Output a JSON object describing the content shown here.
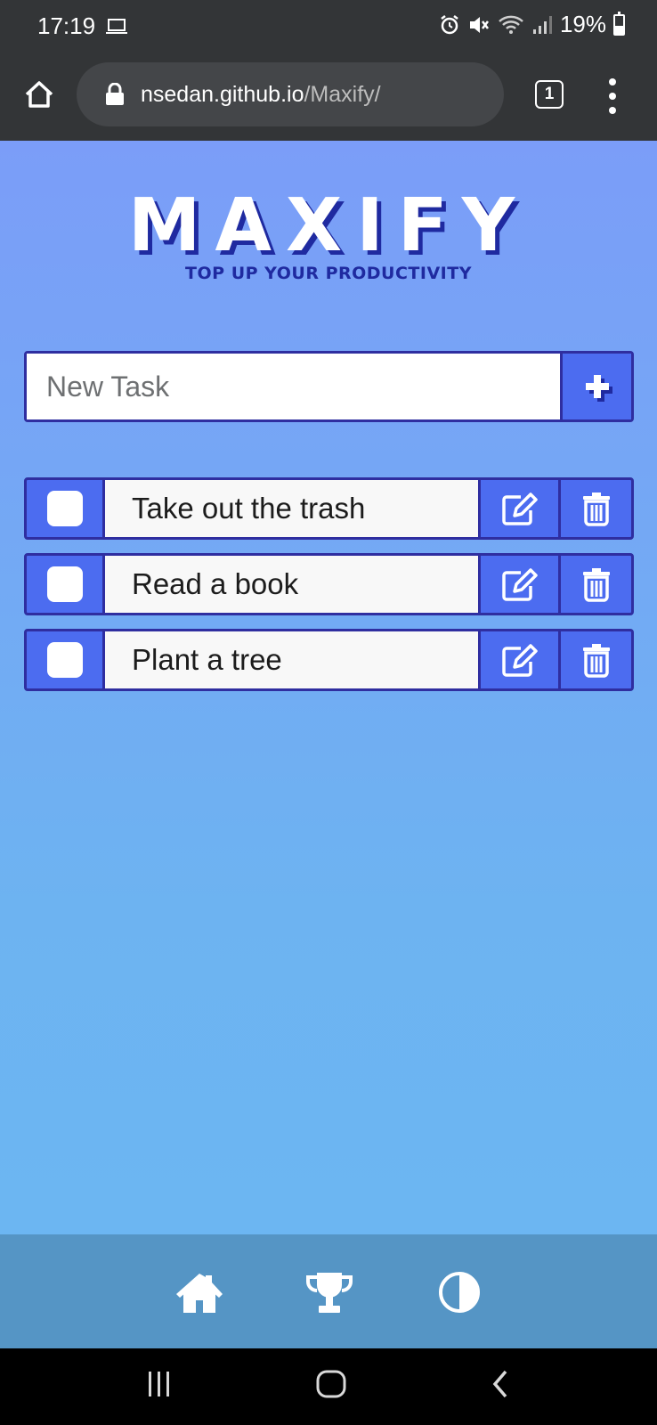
{
  "status_bar": {
    "time": "17:19",
    "battery": "19%",
    "icons": [
      "laptop-icon",
      "alarm-icon",
      "mute-icon",
      "wifi-icon",
      "signal-icon",
      "battery-icon"
    ]
  },
  "browser": {
    "url_host": "nsedan.github.io",
    "url_path": "/Maxify/",
    "tab_count": "1"
  },
  "app": {
    "title": "MAXIFY",
    "tagline": "TOP UP YOUR PRODUCTIVITY",
    "new_task_placeholder": "New Task",
    "new_task_value": "",
    "tasks": [
      {
        "label": "Take out the trash",
        "done": false
      },
      {
        "label": "Read a book",
        "done": false
      },
      {
        "label": "Plant a tree",
        "done": false
      }
    ]
  },
  "footer_nav": [
    "home-icon",
    "trophy-icon",
    "theme-toggle-icon"
  ],
  "system_nav": [
    "recents-icon",
    "home-icon",
    "back-icon"
  ],
  "colors": {
    "top_bar": "#333537",
    "page_gradient_top": "#7b9df8",
    "page_gradient_bottom": "#6cb6f2",
    "accent_blue": "#4c6cf0",
    "border_navy": "#2f2ea0",
    "footer_nav": "#5595c5"
  }
}
